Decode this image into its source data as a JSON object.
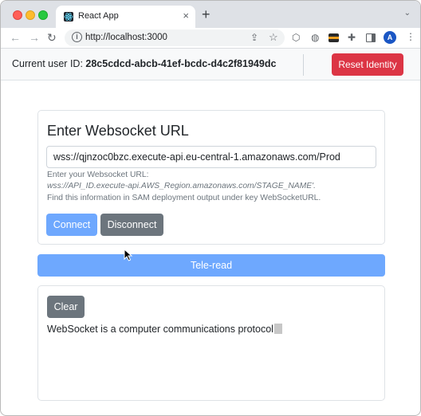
{
  "browser": {
    "tab_title": "React App",
    "tab_close": "×",
    "new_tab": "+",
    "tab_menu": "⌄",
    "url": "http://localhost:3000",
    "back": "←",
    "forward": "→",
    "reload": "↻",
    "info": "i",
    "share": "⇪",
    "star": "☆",
    "ext_hex": "⬡",
    "ext_ball": "◍",
    "ext_puzzle": "✚",
    "avatar": "A",
    "kebab": "⋮"
  },
  "header": {
    "user_id_label": "Current user ID:",
    "user_id": "28c5cdcd-abcb-41ef-bcdc-d4c2f81949dc",
    "reset_label": "Reset Identity",
    "reset_color": "#dc3545"
  },
  "url_card": {
    "title": "Enter Websocket URL",
    "input_value": "wss://qjnzoc0bzc.execute-api.eu-central-1.amazonaws.com/Prod",
    "help_line1": "Enter your Websocket URL:",
    "help_line2": "wss://API_ID.execute-api.AWS_Region.amazonaws.com/STAGE_NAME'.",
    "help_line3": "Find this information in SAM deployment output under key WebSocketURL.",
    "connect_label": "Connect",
    "disconnect_label": "Disconnect",
    "primary_color": "#6ea8fe",
    "secondary_color": "#6c757d"
  },
  "teleread_label": "Tele-read",
  "output_card": {
    "clear_label": "Clear",
    "text": "WebSocket is a computer communications protocol"
  }
}
